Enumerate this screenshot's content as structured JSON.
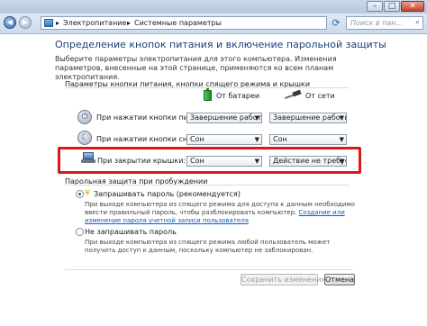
{
  "window": {
    "min_label": "–",
    "max_label": "□",
    "close_label": "✕"
  },
  "nav": {
    "back_icon": "arrow-left-icon",
    "forward_icon": "arrow-right-icon",
    "breadcrumbs": [
      "Электропитание",
      "Системные параметры"
    ],
    "separator": "▸",
    "search_placeholder": "Поиск в пан…",
    "refresh_icon": "refresh-icon",
    "search_icon": "magnifier-icon"
  },
  "page": {
    "title": "Определение кнопок питания и включение парольной защиты",
    "description": "Выберите параметры электропитания для этого компьютера. Изменения параметров, внесенные на этой странице, применяются ко всем планам электропитания."
  },
  "settings": {
    "group_label": "Параметры кнопки питания, кнопки спящего режима и крышки",
    "columns": {
      "battery": "От батареи",
      "ac": "От сети"
    },
    "rows": [
      {
        "label": "При нажатии кнопки питания:",
        "battery": "Завершение работы",
        "ac": "Завершение работы",
        "icon": "power-button-icon"
      },
      {
        "label": "При нажатии кнопки сна:",
        "battery": "Сон",
        "ac": "Сон",
        "icon": "sleep-moon-icon"
      },
      {
        "label": "При закрытии крышки:",
        "battery": "Сон",
        "ac": "Действие не требуется",
        "icon": "laptop-lid-icon"
      }
    ]
  },
  "password": {
    "group_label": "Парольная защита при пробуждении",
    "require": {
      "label": "Запрашивать пароль (рекомендуется)",
      "description": "При выходе компьютера из спящего режима для доступа к данным необходимо ввести правильный пароль, чтобы разблокировать компьютер.",
      "link": "Создание или изменение пароля учетной записи пользователя",
      "checked": true
    },
    "no_require": {
      "label": "Не запрашивать пароль",
      "description": "При выходе компьютера из спящего режима любой пользователь может получить доступ к данным, поскольку компьютер не заблокирован.",
      "checked": false
    }
  },
  "buttons": {
    "save": "Сохранить изменения",
    "cancel": "Отмена"
  },
  "colors": {
    "highlight": "#d9181a",
    "title": "#1d3c7a",
    "link": "#0b5cc5"
  }
}
